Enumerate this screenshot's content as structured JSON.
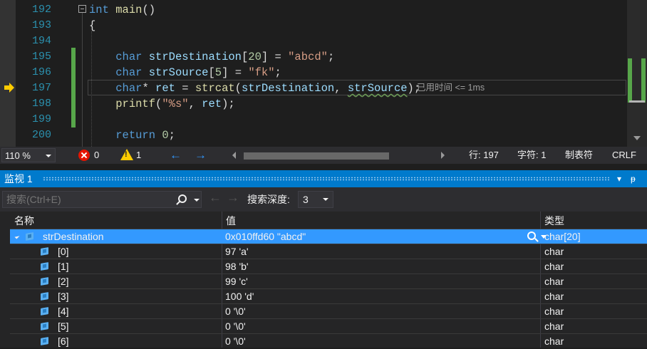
{
  "colors": {
    "accent": "#007acc",
    "selection": "#3399ff",
    "change_bar": "#57a64a",
    "keyword": "#569cd6",
    "string": "#d69d85"
  },
  "editor": {
    "lines": [
      {
        "number": "192",
        "tokens": [
          {
            "t": "int",
            "c": "kw"
          },
          {
            "t": " "
          },
          {
            "t": "main",
            "c": "fn"
          },
          {
            "t": "()"
          }
        ]
      },
      {
        "number": "193",
        "tokens": [
          {
            "t": "{"
          }
        ]
      },
      {
        "number": "194",
        "tokens": []
      },
      {
        "number": "195",
        "tokens": [
          {
            "t": "    "
          },
          {
            "t": "char",
            "c": "kw"
          },
          {
            "t": " "
          },
          {
            "t": "strDestination",
            "c": "var"
          },
          {
            "t": "["
          },
          {
            "t": "20",
            "c": "num"
          },
          {
            "t": "] = "
          },
          {
            "t": "\"abcd\"",
            "c": "str"
          },
          {
            "t": ";"
          }
        ]
      },
      {
        "number": "196",
        "tokens": [
          {
            "t": "    "
          },
          {
            "t": "char",
            "c": "kw"
          },
          {
            "t": " "
          },
          {
            "t": "strSource",
            "c": "var"
          },
          {
            "t": "["
          },
          {
            "t": "5",
            "c": "num"
          },
          {
            "t": "] = "
          },
          {
            "t": "\"fk\"",
            "c": "str"
          },
          {
            "t": ";"
          }
        ]
      },
      {
        "number": "197",
        "tokens": [
          {
            "t": "    "
          },
          {
            "t": "char",
            "c": "kw"
          },
          {
            "t": "* "
          },
          {
            "t": "ret",
            "c": "var"
          },
          {
            "t": " = "
          },
          {
            "t": "strcat",
            "c": "fn"
          },
          {
            "t": "("
          },
          {
            "t": "strDestination",
            "c": "var"
          },
          {
            "t": ", "
          },
          {
            "t": "strSource",
            "c": "var wavy"
          },
          {
            "t": ");"
          }
        ]
      },
      {
        "number": "198",
        "tokens": [
          {
            "t": "    "
          },
          {
            "t": "printf",
            "c": "fn"
          },
          {
            "t": "("
          },
          {
            "t": "\"%s\"",
            "c": "str"
          },
          {
            "t": ", "
          },
          {
            "t": "ret",
            "c": "var"
          },
          {
            "t": ");"
          }
        ]
      },
      {
        "number": "199",
        "tokens": []
      },
      {
        "number": "200",
        "tokens": [
          {
            "t": "    "
          },
          {
            "t": "return",
            "c": "kw"
          },
          {
            "t": " "
          },
          {
            "t": "0",
            "c": "num"
          },
          {
            "t": ";"
          }
        ]
      }
    ],
    "perf_tip": "已用时间 <= 1ms"
  },
  "status": {
    "zoom": "110 %",
    "errors": "0",
    "warnings": "1",
    "line": "行: 197",
    "char": "字符: 1",
    "tabs": "制表符",
    "eol": "CRLF"
  },
  "watch": {
    "title": "监视 1",
    "pin_caret": "▾",
    "pin": "ᵽ",
    "close": "✕",
    "search_placeholder": "搜索(Ctrl+E)",
    "depth_label": "搜索深度:",
    "depth_value": "3",
    "columns": {
      "name": "名称",
      "value": "值",
      "type": "类型"
    },
    "rows": [
      {
        "name": "strDestination",
        "value": "0x010ffd60 \"abcd\"",
        "type": "char[20]"
      },
      {
        "name": "[0]",
        "value": "97 'a'",
        "type": "char"
      },
      {
        "name": "[1]",
        "value": "98 'b'",
        "type": "char"
      },
      {
        "name": "[2]",
        "value": "99 'c'",
        "type": "char"
      },
      {
        "name": "[3]",
        "value": "100 'd'",
        "type": "char"
      },
      {
        "name": "[4]",
        "value": "0 '\\0'",
        "type": "char"
      },
      {
        "name": "[5]",
        "value": "0 '\\0'",
        "type": "char"
      },
      {
        "name": "[6]",
        "value": "0 '\\0'",
        "type": "char"
      }
    ]
  }
}
